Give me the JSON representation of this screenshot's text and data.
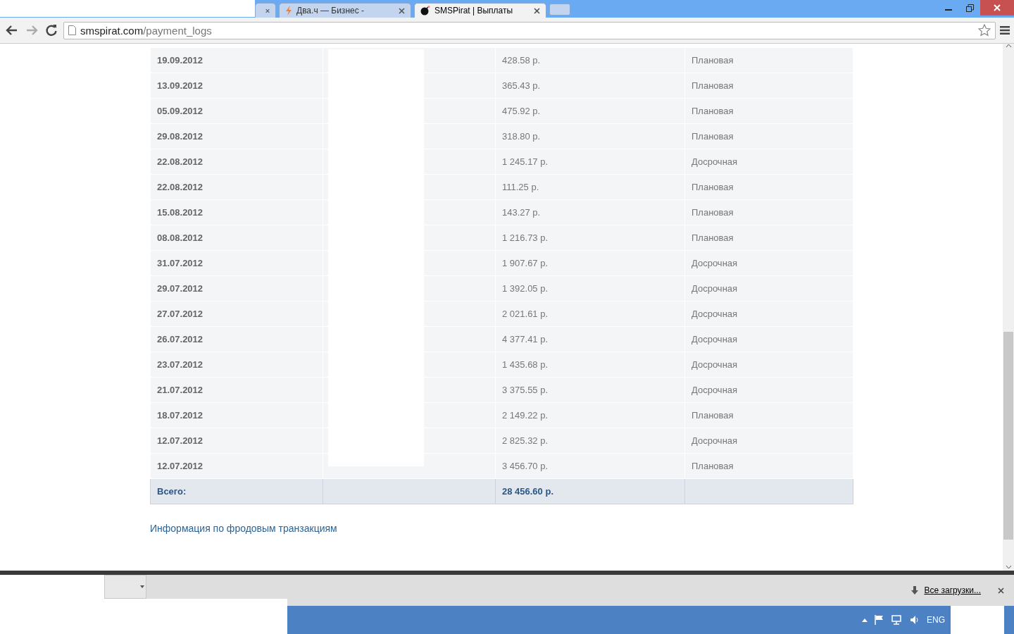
{
  "browser": {
    "tabs": [
      {
        "selected": false
      },
      {
        "title": "Два.ч — Бизнес -",
        "selected": false,
        "kind": "bolt"
      },
      {
        "title": "SMSPirat | Выплаты",
        "selected": true,
        "kind": "bomb"
      }
    ],
    "address": {
      "host": "smspirat.com",
      "path": "/payment_logs"
    }
  },
  "table": {
    "rows": [
      {
        "date": "19.09.2012",
        "amount": "428.58 р.",
        "type": "Плановая"
      },
      {
        "date": "13.09.2012",
        "amount": "365.43 р.",
        "type": "Плановая"
      },
      {
        "date": "05.09.2012",
        "amount": "475.92 р.",
        "type": "Плановая"
      },
      {
        "date": "29.08.2012",
        "amount": "318.80 р.",
        "type": "Плановая"
      },
      {
        "date": "22.08.2012",
        "amount": "1 245.17 р.",
        "type": "Досрочная"
      },
      {
        "date": "22.08.2012",
        "amount": "111.25 р.",
        "type": "Плановая"
      },
      {
        "date": "15.08.2012",
        "amount": "143.27 р.",
        "type": "Плановая"
      },
      {
        "date": "08.08.2012",
        "amount": "1 216.73 р.",
        "type": "Плановая"
      },
      {
        "date": "31.07.2012",
        "amount": "1 907.67 р.",
        "type": "Досрочная"
      },
      {
        "date": "29.07.2012",
        "amount": "1 392.05 р.",
        "type": "Досрочная"
      },
      {
        "date": "27.07.2012",
        "amount": "2 021.61 р.",
        "type": "Досрочная"
      },
      {
        "date": "26.07.2012",
        "amount": "4 377.41 р.",
        "type": "Досрочная"
      },
      {
        "date": "23.07.2012",
        "amount": "1 435.68 р.",
        "type": "Досрочная"
      },
      {
        "date": "21.07.2012",
        "amount": "3 375.55 р.",
        "type": "Досрочная"
      },
      {
        "date": "18.07.2012",
        "amount": "2 149.22 р.",
        "type": "Плановая"
      },
      {
        "date": "12.07.2012",
        "amount": "2 825.32 р.",
        "type": "Досрочная"
      },
      {
        "date": "12.07.2012",
        "amount": "3 456.70 р.",
        "type": "Плановая"
      }
    ],
    "total": {
      "label": "Всего:",
      "amount": "28 456.60 р."
    }
  },
  "fraud_link": "Информация по фродовым транзакциям",
  "downloads_bar": {
    "all_downloads": "Все загрузки..."
  },
  "taskbar": {
    "language": "ENG"
  }
}
